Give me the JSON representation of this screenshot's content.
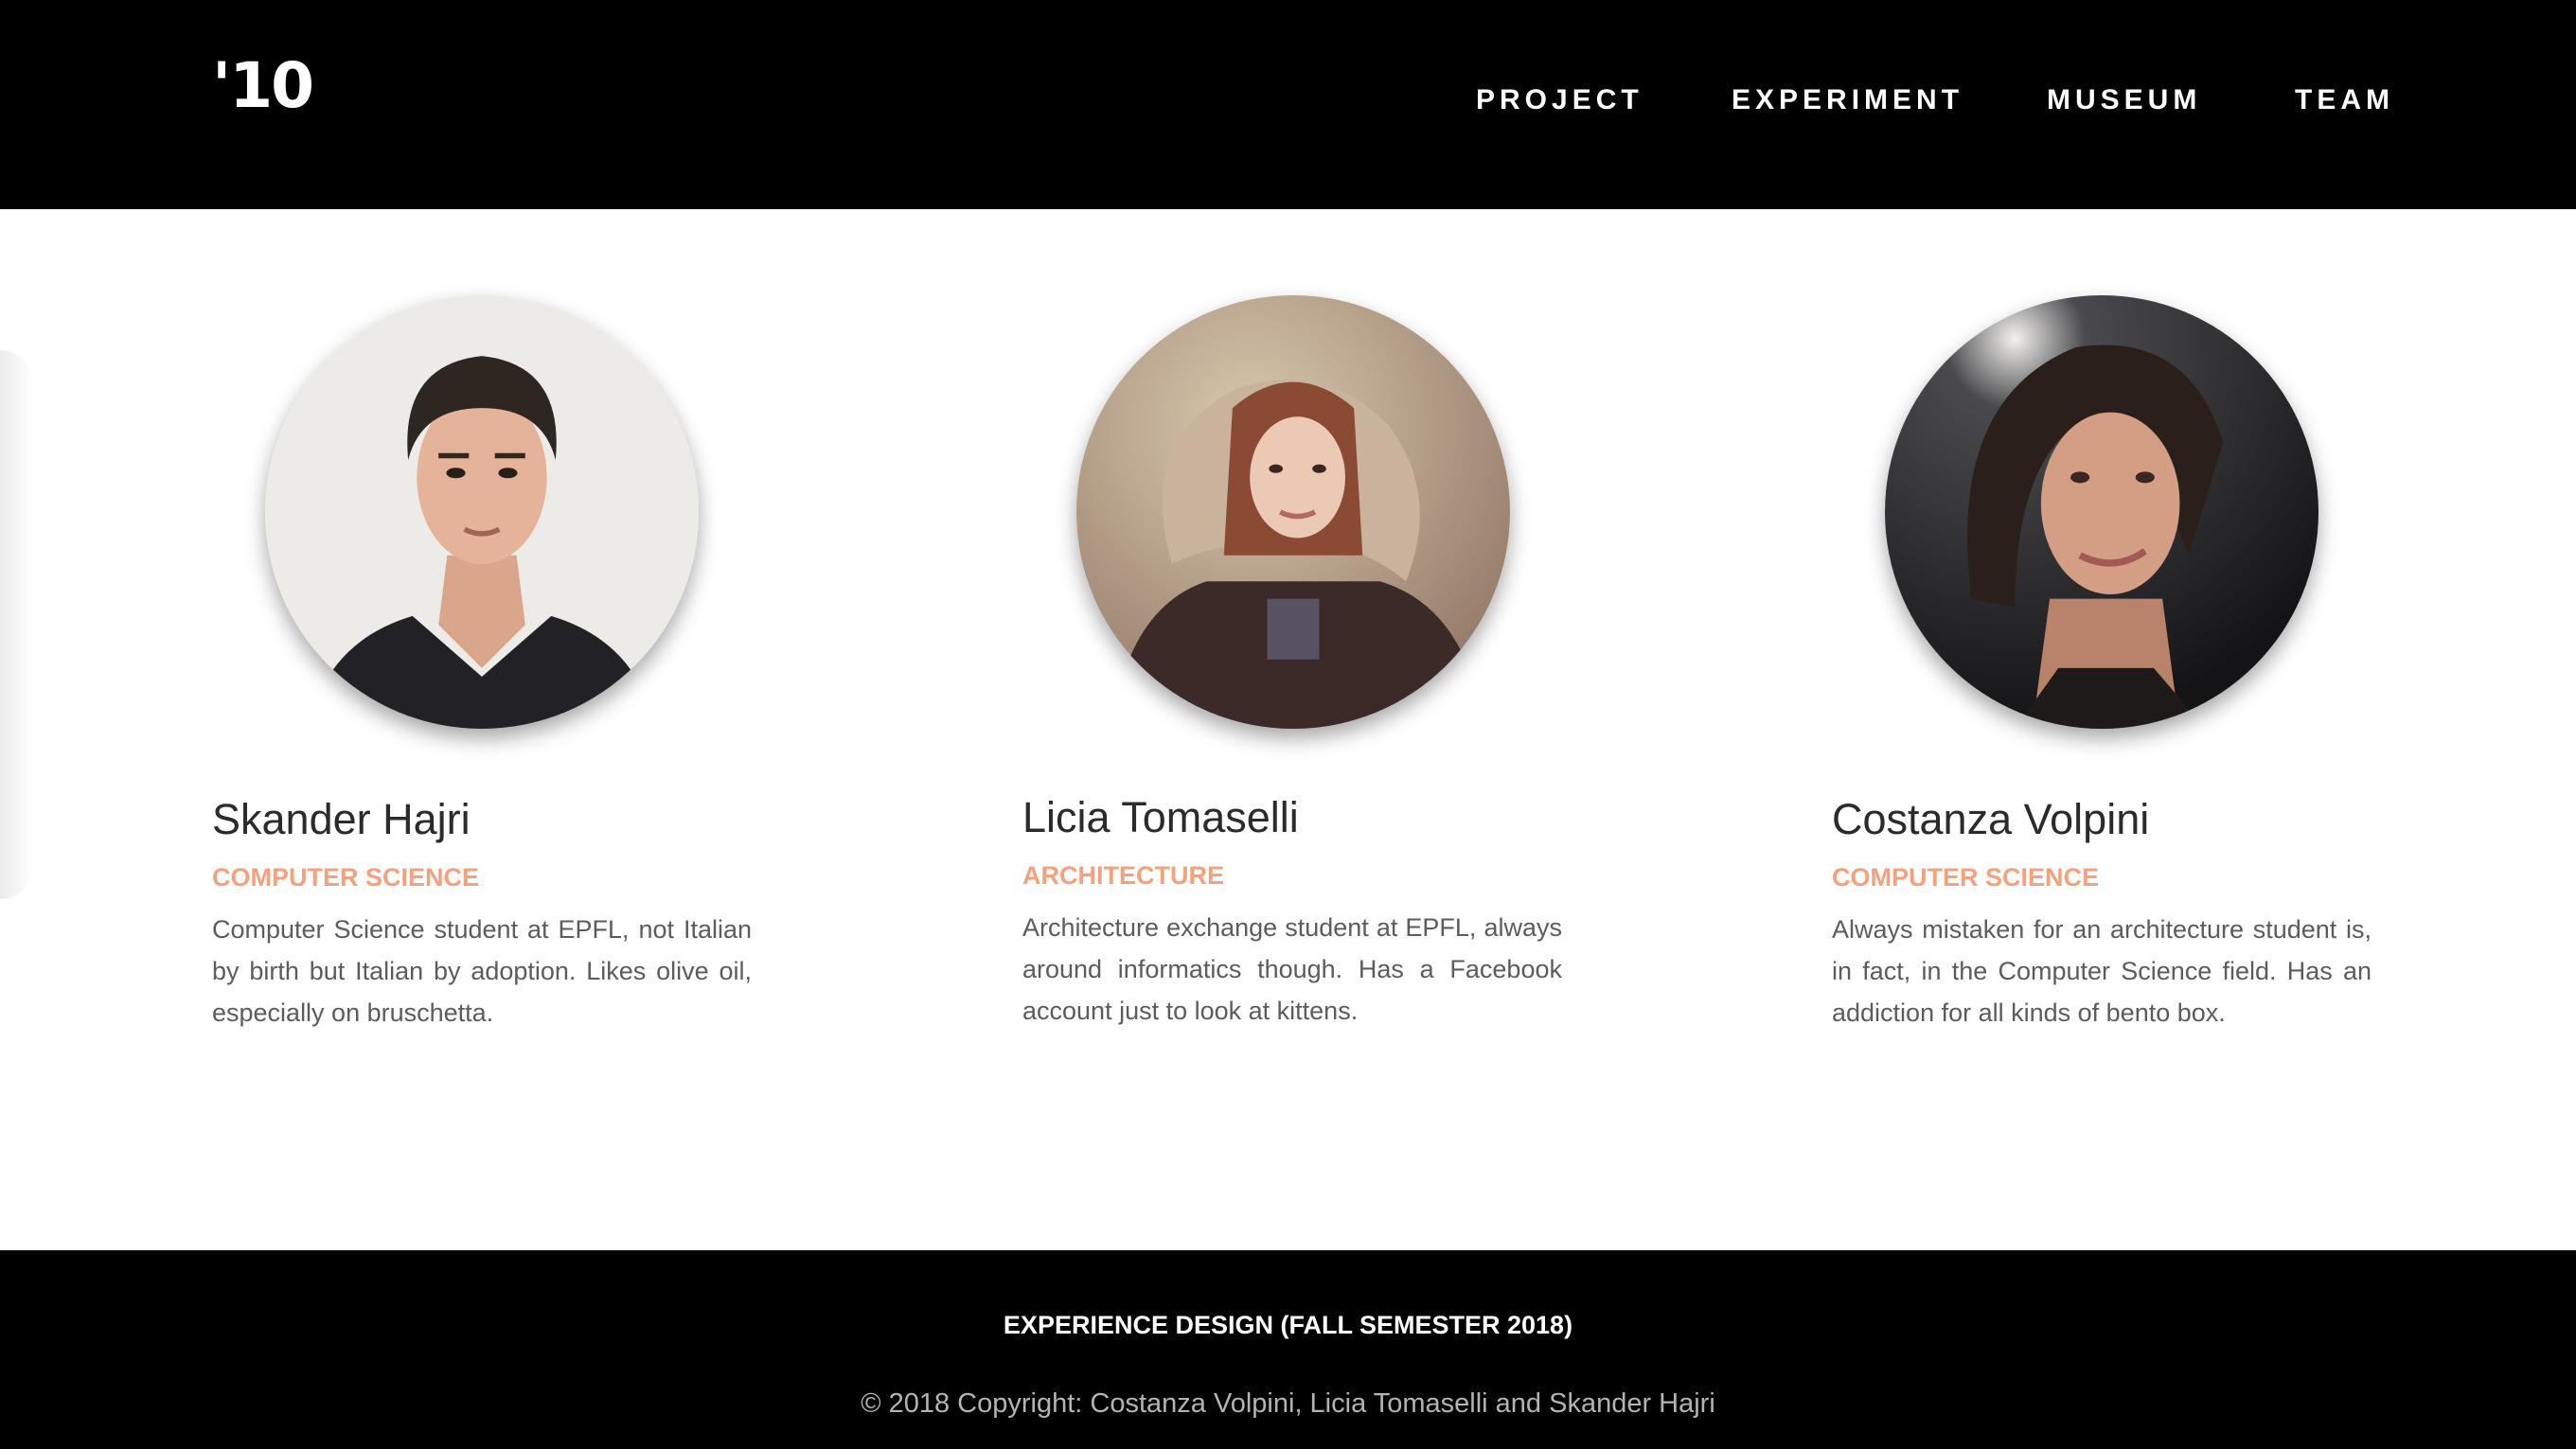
{
  "header": {
    "logo": "'10",
    "nav": [
      {
        "label": "PROJECT"
      },
      {
        "label": "EXPERIMENT"
      },
      {
        "label": "MUSEUM"
      },
      {
        "label": "TEAM"
      }
    ]
  },
  "team": [
    {
      "name": "Skander Hajri",
      "department": "COMPUTER SCIENCE",
      "bio": "Computer Science student at EPFL, not Italian by birth but Italian by adoption. Likes olive oil, especially on bruschetta."
    },
    {
      "name": "Licia Tomaselli",
      "department": "ARCHITECTURE",
      "bio": "Architecture exchange student at EPFL, always around informatics though. Has a Facebook account just to look at kittens."
    },
    {
      "name": "Costanza Volpini",
      "department": "COMPUTER SCIENCE",
      "bio": "Always mistaken for an architecture student is, in fact, in the Computer Science field. Has an addiction for all kinds of bento box."
    }
  ],
  "footer": {
    "title": "EXPERIENCE DESIGN (FALL SEMESTER 2018)",
    "copyright": "© 2018 Copyright: Costanza Volpini, Licia Tomaselli and Skander Hajri"
  },
  "colors": {
    "header_bg": "#000000",
    "accent": "#f4a27e",
    "body_text": "#5c5c5c",
    "name_text": "#2b2b2b"
  }
}
